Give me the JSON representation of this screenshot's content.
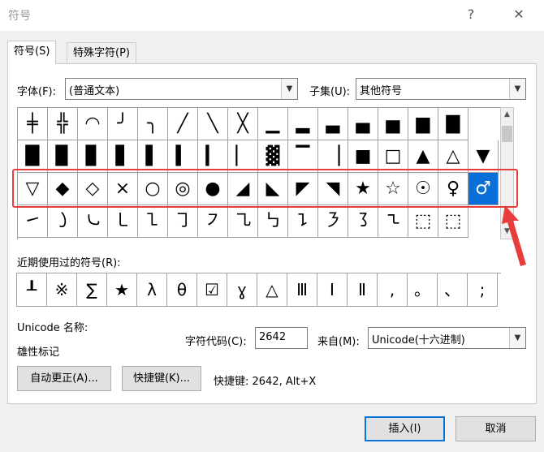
{
  "window": {
    "title": "符号",
    "help_label": "?",
    "close_label": "✕"
  },
  "tabs": [
    {
      "label": "符号(S)",
      "active": true
    },
    {
      "label": "特殊字符(P)",
      "active": false
    }
  ],
  "font": {
    "label": "字体(F):",
    "value": "(普通文本)"
  },
  "subset": {
    "label": "子集(U):",
    "value": "其他符号"
  },
  "symbol_grid": {
    "rows": [
      [
        "╪",
        "╬",
        "◠",
        "╯",
        "╮",
        "╱",
        "╲",
        "╳",
        "▁",
        "▂",
        "▃",
        "▄",
        "▅",
        "▆",
        "▇"
      ],
      [
        "█",
        "▉",
        "▊",
        "▋",
        "▌",
        "▍",
        "▎",
        "▏",
        "▓",
        "▔",
        "▕",
        "■",
        "□",
        "▲",
        "△",
        "▼"
      ],
      [
        "▽",
        "◆",
        "◇",
        "×",
        "○",
        "◎",
        "●",
        "◢",
        "◣",
        "◤",
        "◥",
        "★",
        "☆",
        "☉",
        "♀",
        "♂"
      ],
      [
        "㇀",
        "㇁",
        "㇃",
        "㇄",
        "㇅",
        "㇆",
        "㇇",
        "㇈",
        "㇉",
        "㇊",
        "㇋",
        "㇌",
        "㇍",
        "⬚",
        "⬚"
      ]
    ],
    "selected": "♂",
    "scroll_up": "▲",
    "scroll_down": "▼"
  },
  "recent": {
    "label": "近期使用过的符号(R):",
    "symbols": [
      "┸",
      "※",
      "∑",
      "★",
      "λ",
      "θ",
      "☑",
      "ɣ",
      "△",
      "Ⅲ",
      "Ⅰ",
      "Ⅱ",
      ",",
      "。",
      "、",
      ";"
    ]
  },
  "unicode_name": {
    "label": "Unicode 名称:",
    "value": "雄性标记"
  },
  "char_code": {
    "label": "字符代码(C):",
    "value": "2642"
  },
  "from": {
    "label": "来自(M):",
    "value": "Unicode(十六进制)"
  },
  "buttons": {
    "autocorrect": "自动更正(A)...",
    "shortcut_key": "快捷键(K)...",
    "shortcut_text": "快捷键: 2642, Alt+X",
    "insert": "插入(I)",
    "cancel": "取消"
  },
  "colors": {
    "selection": "#0a6fd8",
    "highlight_box": "#e83d3d",
    "arrow": "#e83d3d",
    "primary_border": "#0a74d8"
  },
  "icons": {
    "arrow": "red-arrow-pointer"
  }
}
